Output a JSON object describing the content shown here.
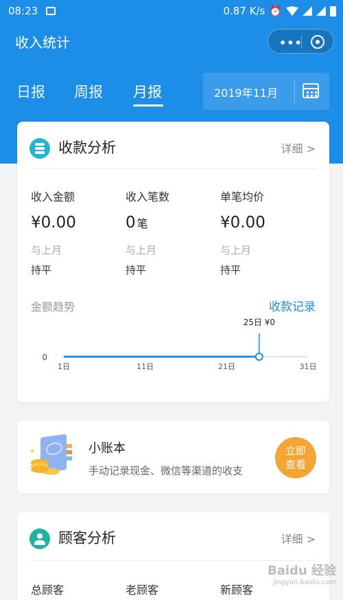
{
  "status_bar": {
    "time": "08:23",
    "speed": "0.87 K/s"
  },
  "appbar": {
    "title": "收入统计",
    "more_label": "•••"
  },
  "tabs": [
    {
      "label": "日报"
    },
    {
      "label": "周报"
    },
    {
      "label": "月报"
    }
  ],
  "active_tab": "月报",
  "date_picker": {
    "value": "2019年11月"
  },
  "revenue": {
    "title": "收款分析",
    "detail_label": "详细 >",
    "metrics": [
      {
        "label": "收入金额",
        "value": "¥0.00",
        "unit": "",
        "compare_label": "与上月",
        "compare_value": "持平"
      },
      {
        "label": "收入笔数",
        "value": "0",
        "unit": "笔",
        "compare_label": "与上月",
        "compare_value": "持平"
      },
      {
        "label": "单笔均价",
        "value": "¥0.00",
        "unit": "",
        "compare_label": "与上月",
        "compare_value": "持平"
      }
    ],
    "trend_title": "金额趋势",
    "records_link": "收款记录",
    "tooltip": "25日 ¥0"
  },
  "chart_data": {
    "type": "line",
    "x": [
      1,
      11,
      21,
      25,
      31
    ],
    "y": [
      0,
      0,
      0,
      0,
      0
    ],
    "x_ticks": [
      "1日",
      "11日",
      "21日",
      "31日"
    ],
    "x_range": [
      1,
      31
    ],
    "y_tick": "0",
    "highlight": {
      "x": 25,
      "label": "25日 ¥0"
    },
    "grid": false
  },
  "ledger": {
    "title": "小账本",
    "description": "手动记录现金、微信等渠道的收支",
    "button_line1": "立即",
    "button_line2": "查看"
  },
  "customers": {
    "title": "顾客分析",
    "detail_label": "详细 >",
    "metrics": [
      {
        "label": "总顾客"
      },
      {
        "label": "老顾客"
      },
      {
        "label": "新顾客"
      }
    ]
  },
  "watermark": {
    "text": "Baidu 经验",
    "sub": "jingyan.baidu.com"
  },
  "colors": {
    "primary": "#1d8ee8",
    "accent_orange": "#f4a535",
    "teal": "#1fb3a3"
  },
  "icons": [
    "image-icon",
    "alarm-icon",
    "wifi-icon",
    "signal-icon",
    "battery-icon",
    "close-circle-icon",
    "calendar-icon",
    "coins-icon",
    "ledger-book-icon",
    "user-icon"
  ]
}
